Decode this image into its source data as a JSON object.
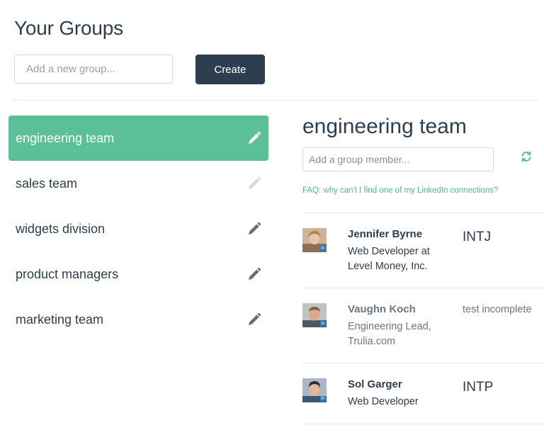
{
  "header": {
    "title": "Your Groups"
  },
  "new_group": {
    "placeholder": "Add a new group...",
    "create_label": "Create"
  },
  "groups": [
    {
      "name": "engineering team",
      "active": true
    },
    {
      "name": "sales team",
      "active": false
    },
    {
      "name": "widgets division",
      "active": false
    },
    {
      "name": "product managers",
      "active": false
    },
    {
      "name": "marketing team",
      "active": false
    }
  ],
  "detail": {
    "title": "engineering team",
    "member_placeholder": "Add a group member...",
    "faq_text": "FAQ: why can't I find one of my LinkedIn connections?",
    "members": [
      {
        "name": "Jennifer Byrne",
        "role": "Web Developer at Level Money, Inc.",
        "type": "INTJ",
        "pending": false
      },
      {
        "name": "Vaughn Koch",
        "role": "Engineering Lead, Trulia.com",
        "type": "test incomplete",
        "pending": true
      },
      {
        "name": "Sol Garger",
        "role": "Web Developer",
        "type": "INTP",
        "pending": false
      }
    ]
  },
  "colors": {
    "accent": "#5bbf98",
    "primary_dark": "#2c3e50",
    "link": "#4cb890",
    "linkedin_badge": "#2a7ab8"
  },
  "icons": {
    "edit": "pencil-icon",
    "refresh": "refresh-icon"
  }
}
